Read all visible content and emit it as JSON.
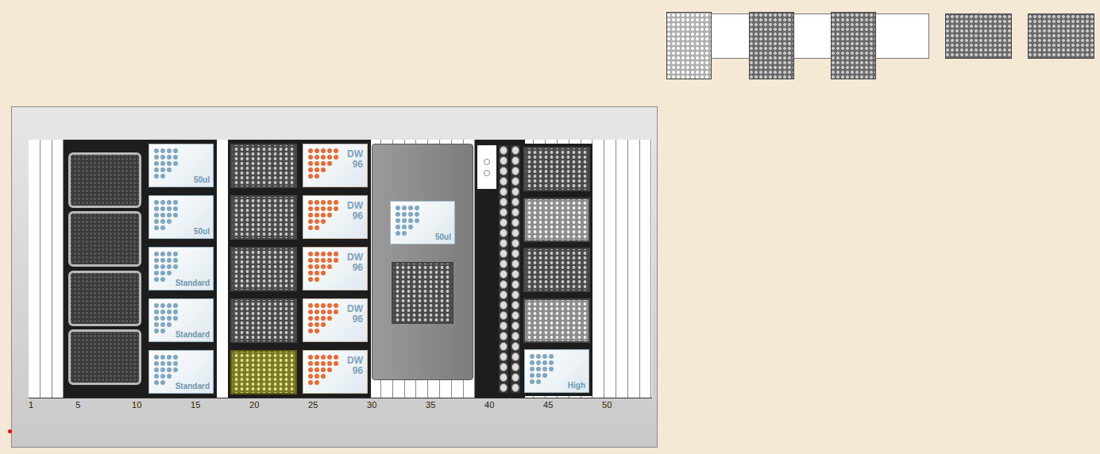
{
  "grid_labels": [
    "1",
    "5",
    "10",
    "15",
    "20",
    "25",
    "30",
    "35",
    "40",
    "45",
    "50"
  ],
  "offsite_plates": [
    {
      "kind": "light"
    },
    {
      "kind": "dark"
    },
    {
      "kind": "dark"
    },
    {
      "kind": "landscape"
    },
    {
      "kind": "landscape"
    }
  ],
  "carriers": [
    {
      "kind": "plate-carrier",
      "slots": [
        {
          "kind": "dark-plate"
        },
        {
          "kind": "dark-plate"
        },
        {
          "kind": "dark-plate"
        },
        {
          "kind": "dark-plate"
        }
      ]
    },
    {
      "kind": "tip-carrier",
      "slots": [
        {
          "kind": "tips",
          "label": "50ul"
        },
        {
          "kind": "tips",
          "label": "50ul"
        },
        {
          "kind": "tips",
          "label": "Standard"
        },
        {
          "kind": "tips",
          "label": "Standard"
        },
        {
          "kind": "tips",
          "label": "Standard"
        }
      ]
    },
    {
      "kind": "plate-carrier",
      "slots": [
        {
          "kind": "plate",
          "selected": false
        },
        {
          "kind": "plate",
          "selected": false
        },
        {
          "kind": "plate",
          "selected": false
        },
        {
          "kind": "plate",
          "selected": false
        },
        {
          "kind": "plate",
          "selected": true
        }
      ]
    },
    {
      "kind": "plate-carrier",
      "slots": [
        {
          "kind": "deepwell",
          "label": "DW",
          "sub": "96"
        },
        {
          "kind": "deepwell",
          "label": "DW",
          "sub": "96"
        },
        {
          "kind": "deepwell",
          "label": "DW",
          "sub": "96"
        },
        {
          "kind": "deepwell",
          "label": "DW",
          "sub": "96"
        },
        {
          "kind": "deepwell",
          "label": "DW",
          "sub": "96"
        }
      ]
    },
    {
      "kind": "shaker",
      "slots": [
        {
          "kind": "tips",
          "label": "50ul"
        },
        {
          "kind": "plate",
          "selected": false
        }
      ]
    },
    {
      "kind": "tube-rack",
      "slots": []
    },
    {
      "kind": "plate-carrier",
      "slots": [
        {
          "kind": "plate",
          "selected": false
        },
        {
          "kind": "plate-square",
          "selected": false
        },
        {
          "kind": "plate",
          "selected": false
        },
        {
          "kind": "plate-square",
          "selected": false
        },
        {
          "kind": "tips",
          "label": "High"
        }
      ]
    }
  ]
}
